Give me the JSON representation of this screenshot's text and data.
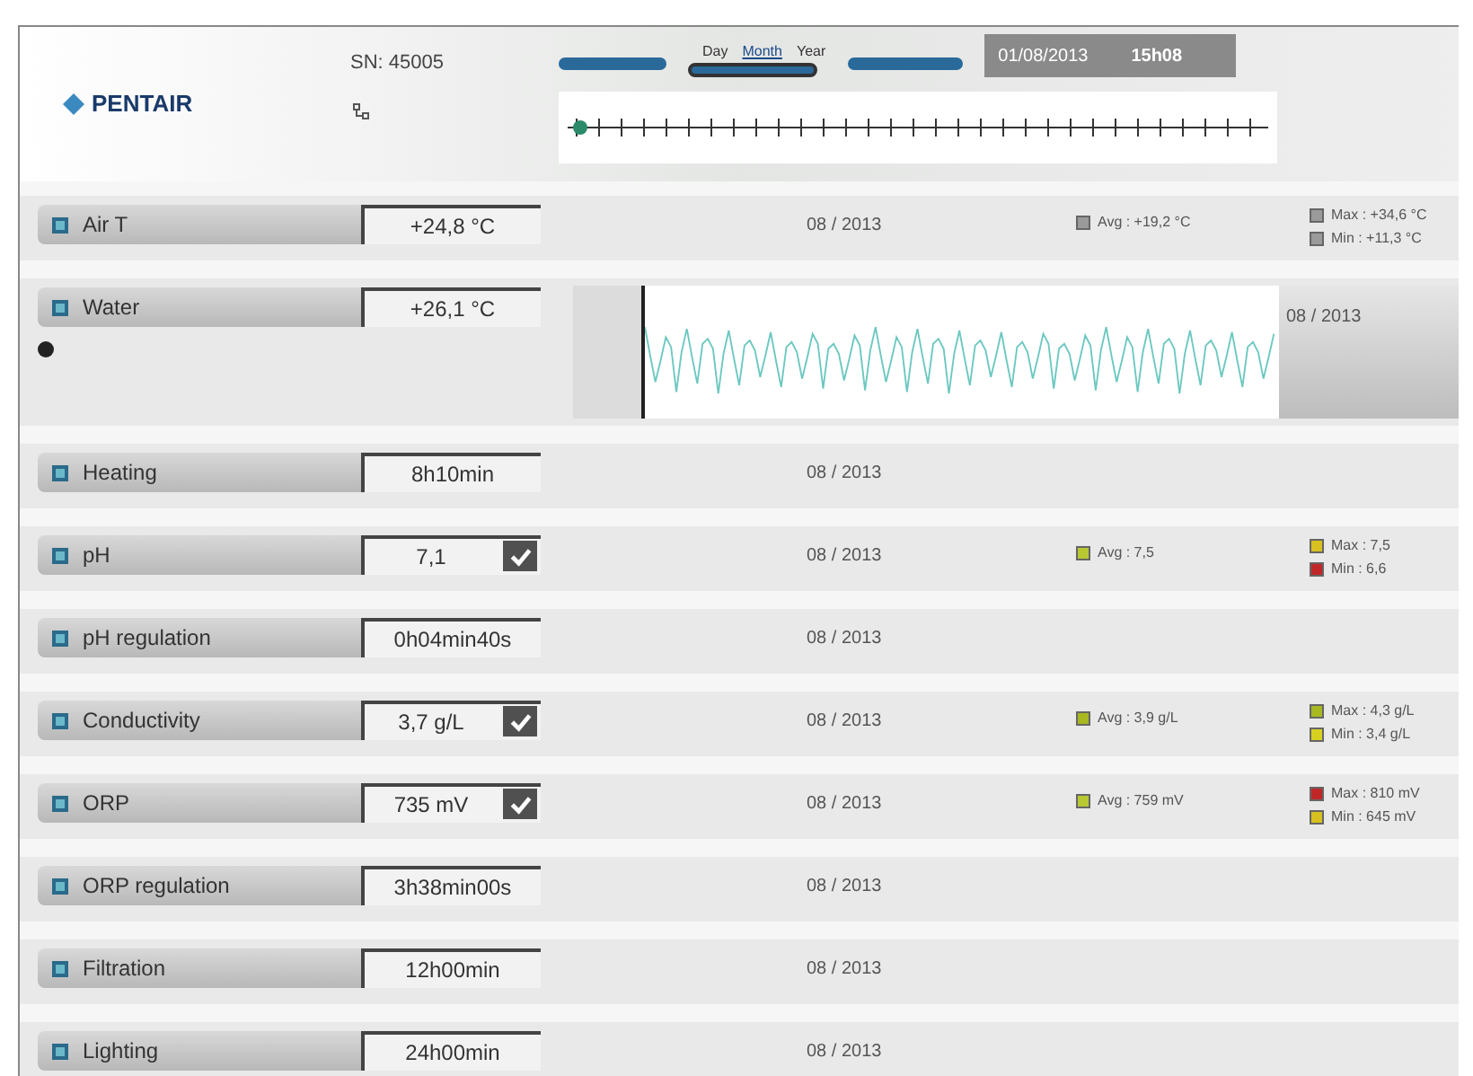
{
  "header": {
    "brand": "PENTAIR",
    "serial": "SN: 45005",
    "period_tabs": [
      {
        "label": "Day",
        "selected": false
      },
      {
        "label": "Month",
        "selected": true
      },
      {
        "label": "Year",
        "selected": false
      }
    ],
    "date": "01/08/2013",
    "time": "15h08"
  },
  "rows": [
    {
      "label": "Air T",
      "value": "+24,8 °C",
      "date": "08 / 2013",
      "avg": {
        "text": "Avg : +19,2 °C",
        "color": "#9a9a9a"
      },
      "max": {
        "text": "Max : +34,6 °C",
        "color": "#9a9a9a"
      },
      "min": {
        "text": "Min : +11,3 °C",
        "color": "#9a9a9a"
      }
    },
    {
      "label": "Water",
      "value": "+26,1 °C",
      "kind": "chart",
      "date": "08 / 2013"
    },
    {
      "label": "Heating",
      "value": "8h10min",
      "date": "08 / 2013"
    },
    {
      "label": "pH",
      "value": "7,1",
      "validated": true,
      "date": "08 / 2013",
      "avg": {
        "text": "Avg : 7,5",
        "color": "#b8c832"
      },
      "max": {
        "text": "Max : 7,5",
        "color": "#d8c020"
      },
      "min": {
        "text": "Min : 6,6",
        "color": "#c02828"
      }
    },
    {
      "label": "pH regulation",
      "value": "0h04min40s",
      "date": "08 / 2013"
    },
    {
      "label": "Conductivity",
      "value": "3,7 g/L",
      "validated": true,
      "date": "08 / 2013",
      "avg": {
        "text": "Avg : 3,9 g/L",
        "color": "#a8b820"
      },
      "max": {
        "text": "Max : 4,3 g/L",
        "color": "#a8b820"
      },
      "min": {
        "text": "Min : 3,4 g/L",
        "color": "#d8d020"
      }
    },
    {
      "label": "ORP",
      "value": "735 mV",
      "validated": true,
      "date": "08 / 2013",
      "avg": {
        "text": "Avg : 759 mV",
        "color": "#b8c832"
      },
      "max": {
        "text": "Max : 810 mV",
        "color": "#c02828"
      },
      "min": {
        "text": "Min : 645 mV",
        "color": "#d8c020"
      }
    },
    {
      "label": "ORP regulation",
      "value": "3h38min00s",
      "date": "08 / 2013"
    },
    {
      "label": "Filtration",
      "value": "12h00min",
      "date": "08 / 2013"
    },
    {
      "label": "Lighting",
      "value": "24h00min",
      "date": "08 / 2013"
    }
  ]
}
